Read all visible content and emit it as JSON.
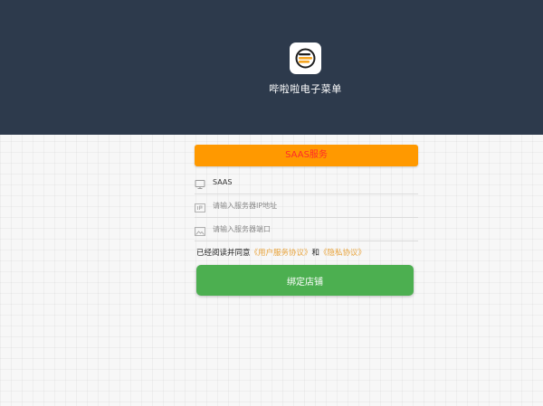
{
  "header": {
    "logo_icon": "receipt-menu-logo-icon",
    "app_title": "哔啦啦电子菜单",
    "background_color": "#2d3a4c"
  },
  "form": {
    "mode_tab_label": "SAAS服务",
    "mode_tab_color": "#ff9900",
    "fields": [
      {
        "icon": "monitor-icon",
        "value": "SAAS",
        "placeholder": ""
      },
      {
        "icon": "ip-icon",
        "value": "",
        "placeholder": "请输入服务器IP地址"
      },
      {
        "icon": "image-icon",
        "value": "",
        "placeholder": "请输入服务器端口"
      }
    ],
    "agreement": {
      "prefix": "已经阅读并同意",
      "user_agreement": "《用户服务协议》",
      "conjunction": "和",
      "privacy_agreement": "《隐私协议》"
    },
    "bind_button_label": "绑定店铺",
    "bind_button_color": "#4caf50"
  }
}
